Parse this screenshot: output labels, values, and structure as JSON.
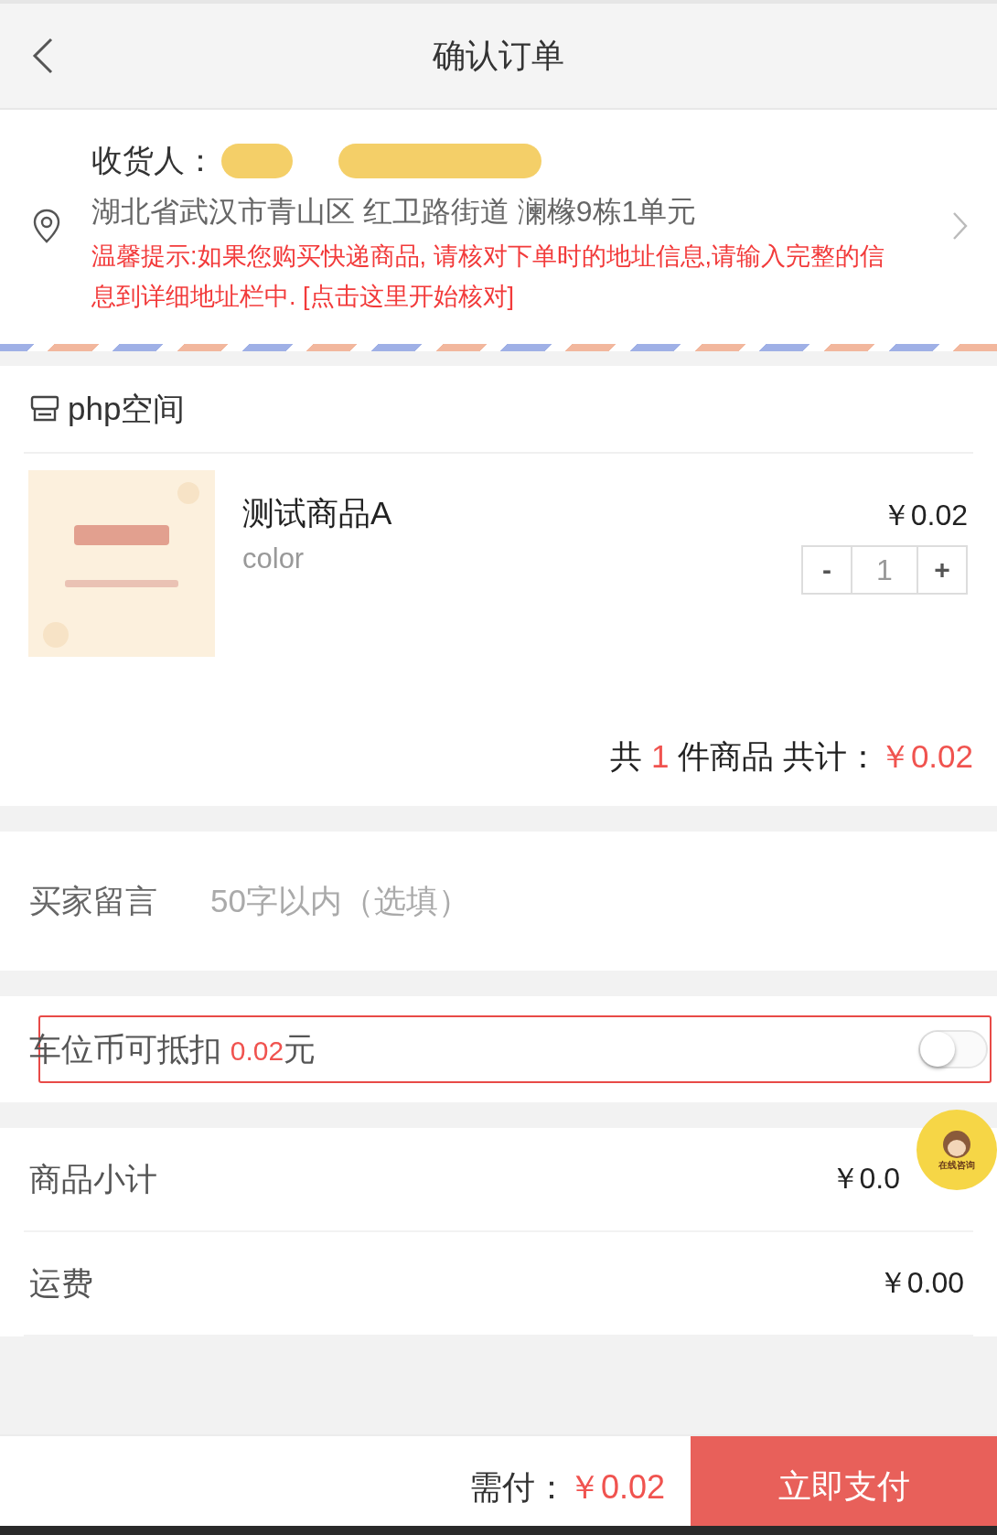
{
  "header": {
    "title": "确认订单"
  },
  "address": {
    "receiver_label": "收货人：",
    "redacted": true,
    "address": "湖北省武汉市青山区 红卫路街道 澜橼9栋1单元",
    "hint": "温馨提示:如果您购买快递商品, 请核对下单时的地址信息,请输入完整的信息到详细地址栏中.",
    "hint_link": "[点击这里开始核对]"
  },
  "shop": {
    "name": "php空间",
    "items": [
      {
        "kind": "picture",
        "name": "测试商品A",
        "spec": "color",
        "price": "￥0.02",
        "quantity": {
          "minus": "-",
          "value": "1",
          "plus": "+"
        }
      }
    ],
    "summary": {
      "prefix": "共",
      "count": "1",
      "middle": "件商品 共计：",
      "total": "￥0.02"
    }
  },
  "message": {
    "label": "买家留言",
    "placeholder": "50字以内（选填）"
  },
  "deduction": {
    "label": "车位币可抵扣",
    "amount": "0.02",
    "unit": "元",
    "on": false
  },
  "costs": [
    {
      "label": "商品小计",
      "value": "￥0.0"
    },
    {
      "label": "运费",
      "value": "￥0.00"
    }
  ],
  "chat": {
    "label": "在线咨询"
  },
  "footer": {
    "label": "需付：",
    "amount": "￥0.02",
    "pay": "立即支付"
  }
}
